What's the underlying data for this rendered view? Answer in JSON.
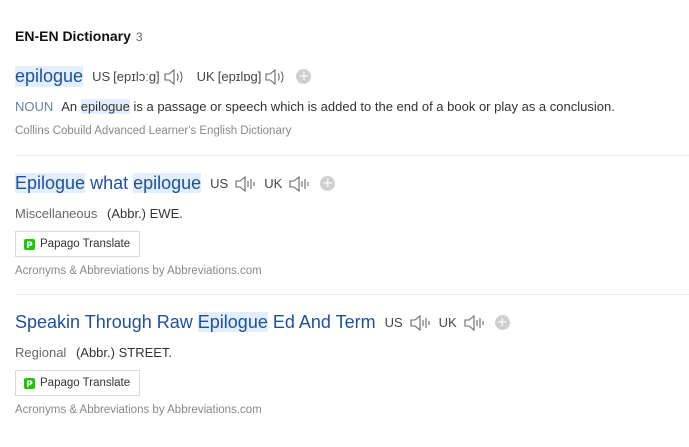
{
  "section": {
    "title": "EN-EN Dictionary",
    "count": "3"
  },
  "entries": [
    {
      "headword": "epilogue",
      "us_label": "US",
      "us_ipa": "[epɪlɔːg]",
      "uk_label": "UK",
      "uk_ipa": "[epɪlɒg]",
      "pos": "NOUN",
      "definition_pre": "An",
      "definition_hl": "epilogue",
      "definition_post": "is a passage or speech which is added to the end of a book or play as a conclusion.",
      "source": "Collins Cobuild Advanced Learner's English Dictionary",
      "add_icon": "plus-icon"
    },
    {
      "headword_part1": "Epilogue",
      "headword_part2": " what ",
      "headword_part3": "epilogue",
      "us_label": "US",
      "uk_label": "UK",
      "category": "Miscellaneous",
      "abbr": "(Abbr.) EWE.",
      "translate_button": "Papago Translate",
      "source": "Acronyms & Abbreviations by Abbreviations.com"
    },
    {
      "headword_part1": "Speakin Through Raw ",
      "headword_part2": "Epilogue",
      "headword_part3": " Ed And Term",
      "us_label": "US",
      "uk_label": "UK",
      "category": "Regional",
      "abbr": "(Abbr.) STREET.",
      "translate_button": "Papago Translate",
      "source": "Acronyms & Abbreviations by Abbreviations.com"
    }
  ],
  "colors": {
    "headword": "#1e50a2",
    "highlight": "#e2eef9",
    "pos": "#6a7ea6",
    "papago_green": "#1ec800",
    "papago_blue": "#2a7de1"
  },
  "icons": {
    "speaker": "speaker-icon",
    "plus": "plus-icon",
    "papago": "papago-logo-icon"
  }
}
